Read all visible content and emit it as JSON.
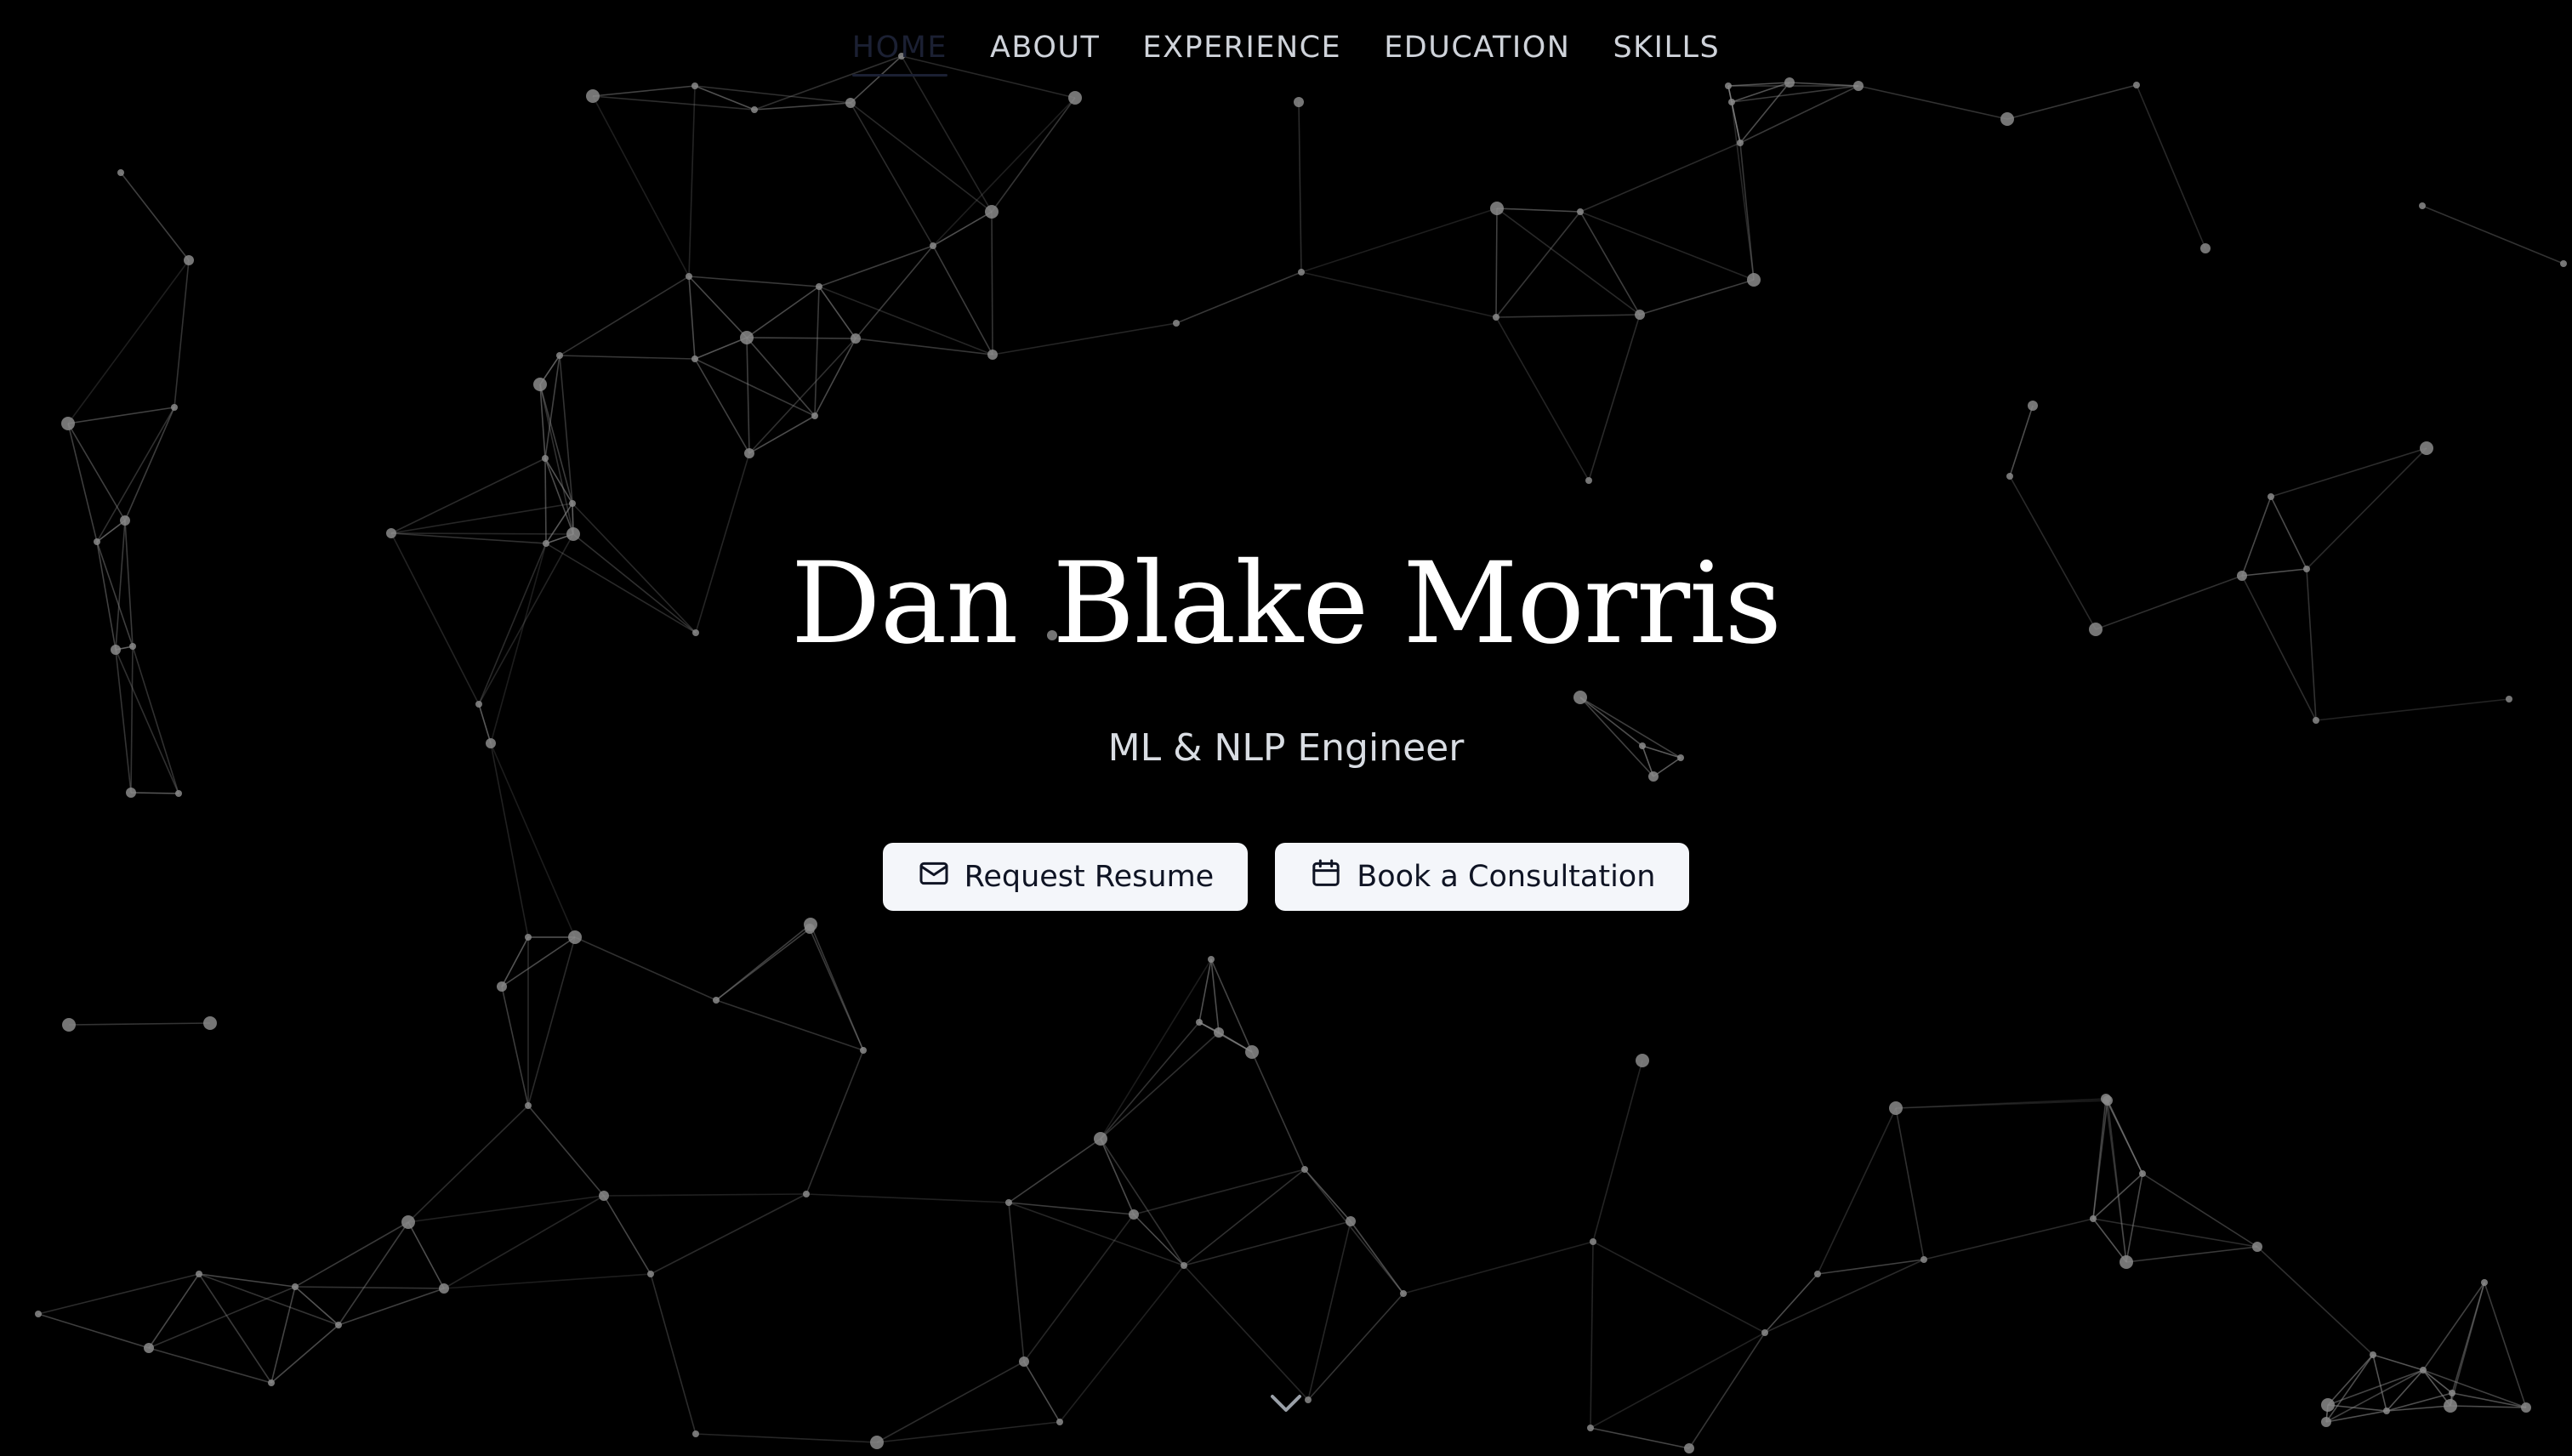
{
  "nav": {
    "items": [
      {
        "label": "HOME",
        "active": true
      },
      {
        "label": "ABOUT",
        "active": false
      },
      {
        "label": "EXPERIENCE",
        "active": false
      },
      {
        "label": "EDUCATION",
        "active": false
      },
      {
        "label": "SKILLS",
        "active": false
      }
    ]
  },
  "hero": {
    "name": "Dan Blake Morris",
    "role": "ML & NLP Engineer",
    "buttons": [
      {
        "label": "Request Resume",
        "icon": "mail-icon"
      },
      {
        "label": "Book a Consultation",
        "icon": "calendar-icon"
      }
    ],
    "scroll_icon": "chevron-down-icon"
  },
  "background": {
    "type": "particle-network",
    "color": "#8a8a8a",
    "page_color": "#000000"
  },
  "colors": {
    "nav_text": "#cfd3da",
    "nav_active": "#1b2033",
    "button_bg": "#f4f6fa",
    "button_text": "#0f1424"
  }
}
